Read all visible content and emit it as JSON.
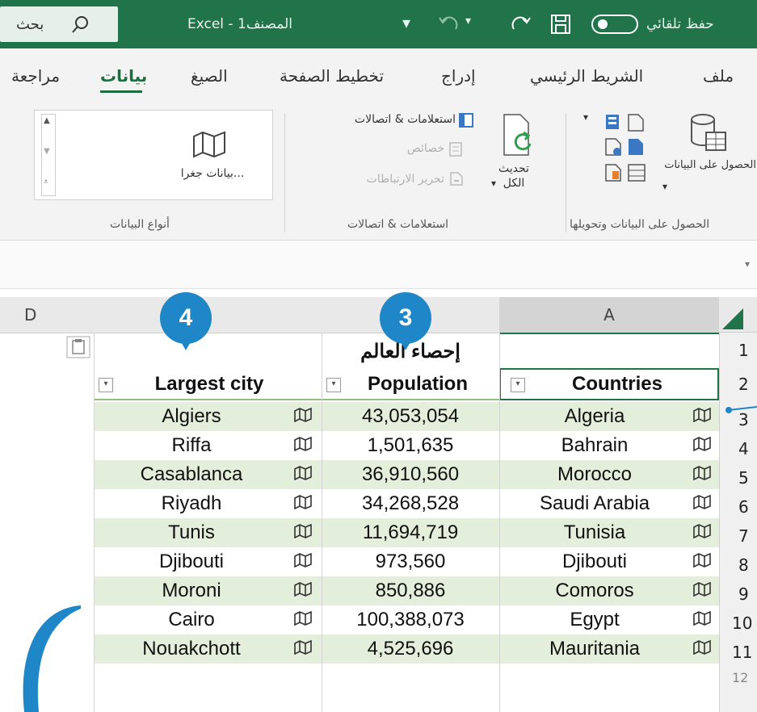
{
  "titlebar": {
    "search_label": "بحث",
    "window_title": "Excel - المصنف1",
    "autosave_label": "حفظ تلقائي"
  },
  "tabs": [
    "ملف",
    "الشريط الرئيسي",
    "إدراج",
    "تخطيط الصفحة",
    "الصيغ",
    "بيانات",
    "مراجعة"
  ],
  "active_tab": "بيانات",
  "ribbon": {
    "get_data_group": {
      "button": "الحصول على البيانات",
      "label": "الحصول على البيانات وتحويلها"
    },
    "queries_group": {
      "refresh_all": "تحديث الكل",
      "queries_connections": "استعلامات & اتصالات",
      "properties": "خصائص",
      "edit_links": "تحرير الارتباطات",
      "label": "استعلامات & اتصالات"
    },
    "data_types_group": {
      "geography": "بيانات جغرا...",
      "label": "أنواع البيانات"
    }
  },
  "grid": {
    "col_headers": [
      "A",
      "D"
    ],
    "row_numbers": [
      "1",
      "2",
      "3",
      "4",
      "5",
      "6",
      "7",
      "8",
      "9",
      "10",
      "11",
      "12"
    ],
    "title_cell": "إحصاء العالم",
    "headers": {
      "countries": "Countries",
      "population": "Population",
      "largest_city": "Largest city"
    },
    "rows": [
      {
        "country": "Algeria",
        "population": "43,053,054",
        "city": "Algiers"
      },
      {
        "country": "Bahrain",
        "population": "1,501,635",
        "city": "Riffa"
      },
      {
        "country": "Morocco",
        "population": "36,910,560",
        "city": "Casablanca"
      },
      {
        "country": "Saudi Arabia",
        "population": "34,268,528",
        "city": "Riyadh"
      },
      {
        "country": "Tunisia",
        "population": "11,694,719",
        "city": "Tunis"
      },
      {
        "country": "Djibouti",
        "population": "973,560",
        "city": "Djibouti"
      },
      {
        "country": "Comoros",
        "population": "850,886",
        "city": "Moroni"
      },
      {
        "country": "Egypt",
        "population": "100,388,073",
        "city": "Cairo"
      },
      {
        "country": "Mauritania",
        "population": "4,525,696",
        "city": "Nouakchott"
      }
    ]
  },
  "callouts": {
    "population_badge": "3",
    "city_badge": "4"
  },
  "colors": {
    "excel_green": "#21734a",
    "band_green": "#e3efdb",
    "callout_blue": "#1f86c7"
  }
}
